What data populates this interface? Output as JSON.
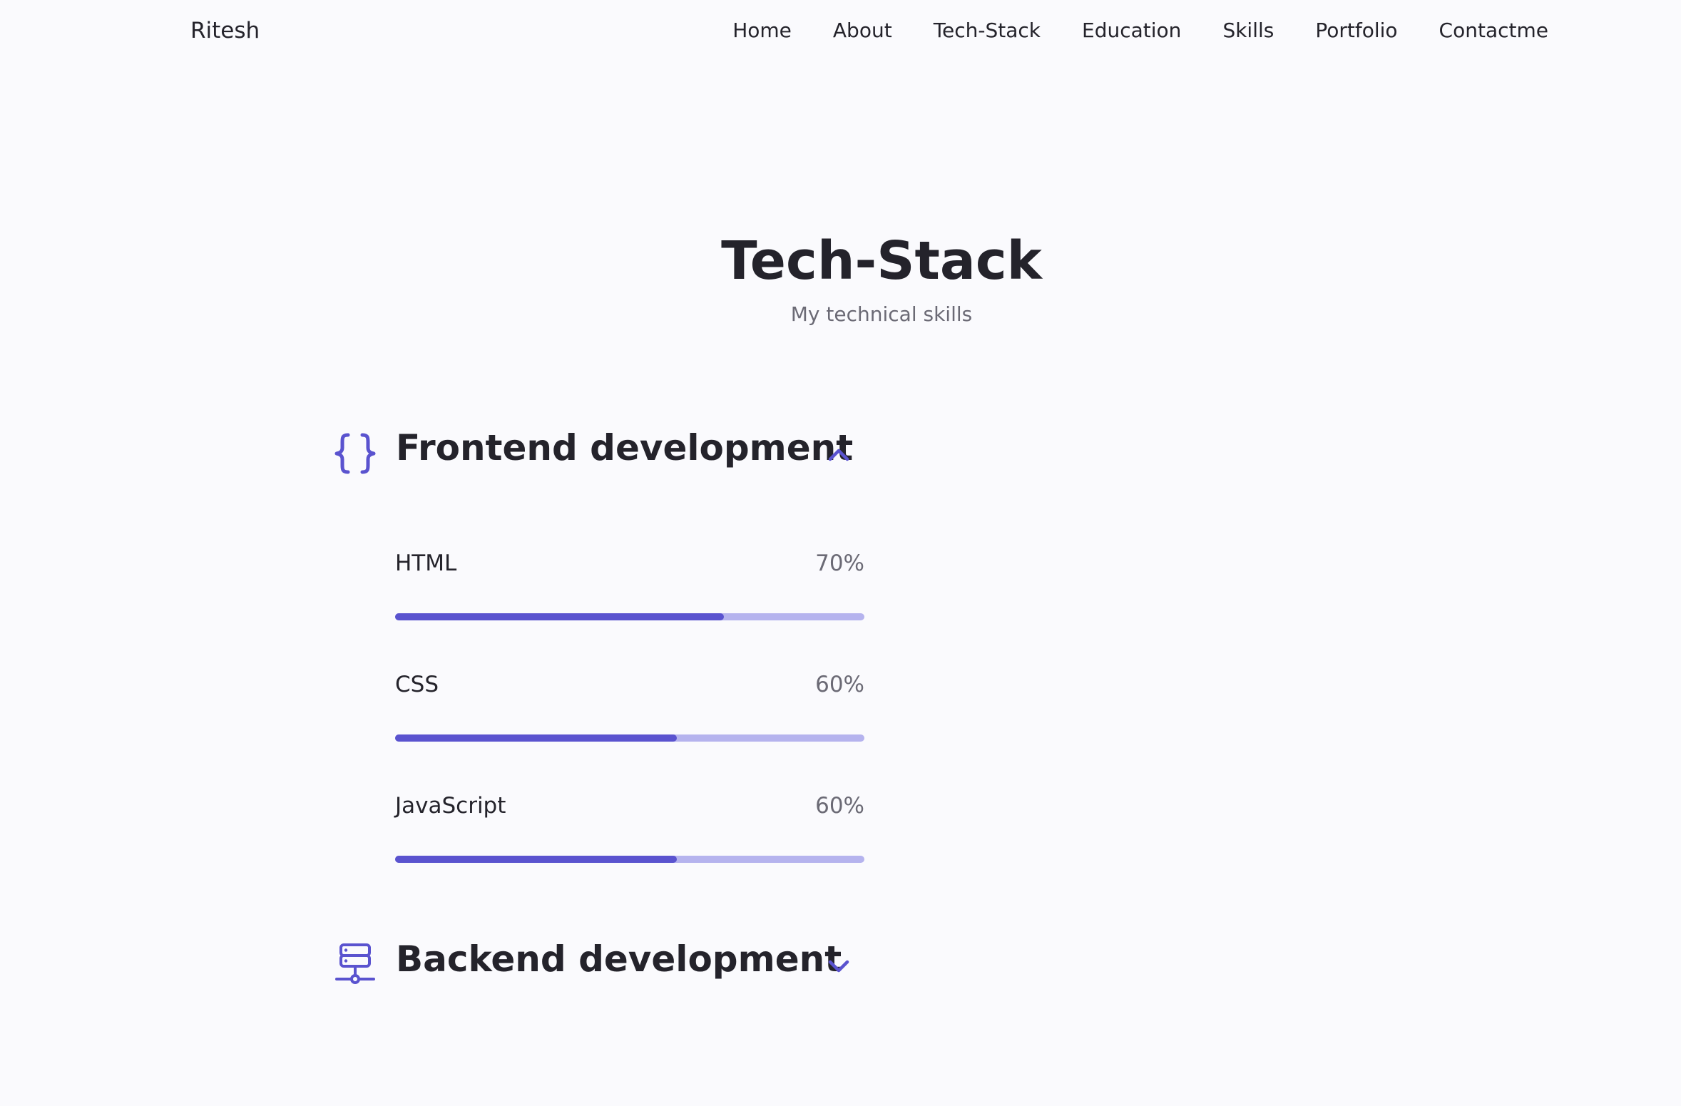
{
  "nav": {
    "brand": "Ritesh",
    "links": [
      "Home",
      "About",
      "Tech-Stack",
      "Education",
      "Skills",
      "Portfolio",
      "Contactme"
    ]
  },
  "section": {
    "title": "Tech-Stack",
    "subtitle": "My technical skills"
  },
  "groups": [
    {
      "title": "Frontend development",
      "icon": "braces-icon",
      "expanded": true,
      "arrow": "chevron-up-icon",
      "skills": [
        {
          "name": "HTML",
          "percent_label": "70%",
          "level": 0.7
        },
        {
          "name": "CSS",
          "percent_label": "60%",
          "level": 0.6
        },
        {
          "name": "JavaScript",
          "percent_label": "60%",
          "level": 0.6
        }
      ]
    },
    {
      "title": "Backend development",
      "icon": "server-icon",
      "expanded": false,
      "arrow": "chevron-down-icon"
    }
  ],
  "colors": {
    "accent": "#5a53cf",
    "accent_light": "#b5b3ee",
    "text": "#24232b",
    "muted": "#6b6a75",
    "background": "#fafafd"
  }
}
